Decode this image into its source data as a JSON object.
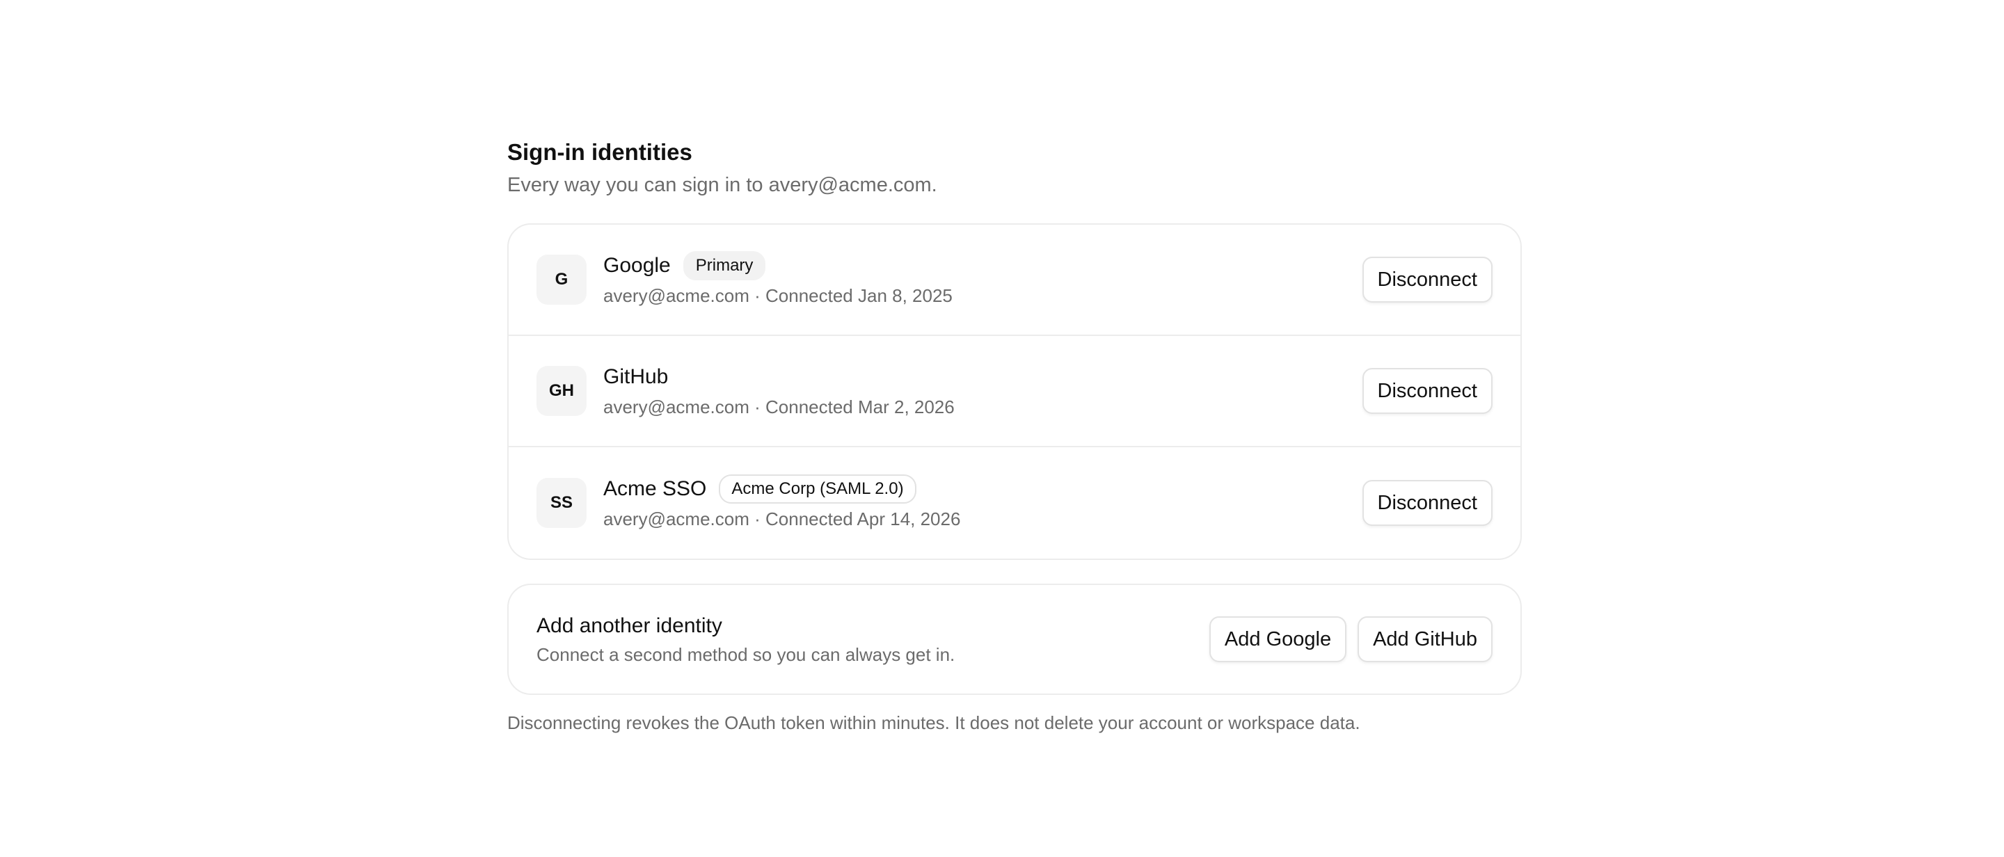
{
  "section": {
    "title": "Sign-in identities",
    "subtitle": "Every way you can sign in to avery@acme.com."
  },
  "identities": [
    {
      "initials": "G",
      "name": "Google",
      "badge": "Primary",
      "meta": "avery@acme.com · Connected Jan 8, 2025",
      "action": "Disconnect"
    },
    {
      "initials": "GH",
      "name": "GitHub",
      "meta": "avery@acme.com · Connected Mar 2, 2026",
      "action": "Disconnect"
    },
    {
      "initials": "SS",
      "name": "Acme SSO",
      "badge": "Acme Corp (SAML 2.0)",
      "meta": "avery@acme.com · Connected Apr 14, 2026",
      "action": "Disconnect"
    }
  ],
  "add_identity": {
    "title": "Add another identity",
    "description": "Connect a second method so you can always get in.",
    "add_google_label": "Add Google",
    "add_github_label": "Add GitHub"
  },
  "footnote": "Disconnecting revokes the OAuth token within minutes. It does not delete your account or workspace data."
}
